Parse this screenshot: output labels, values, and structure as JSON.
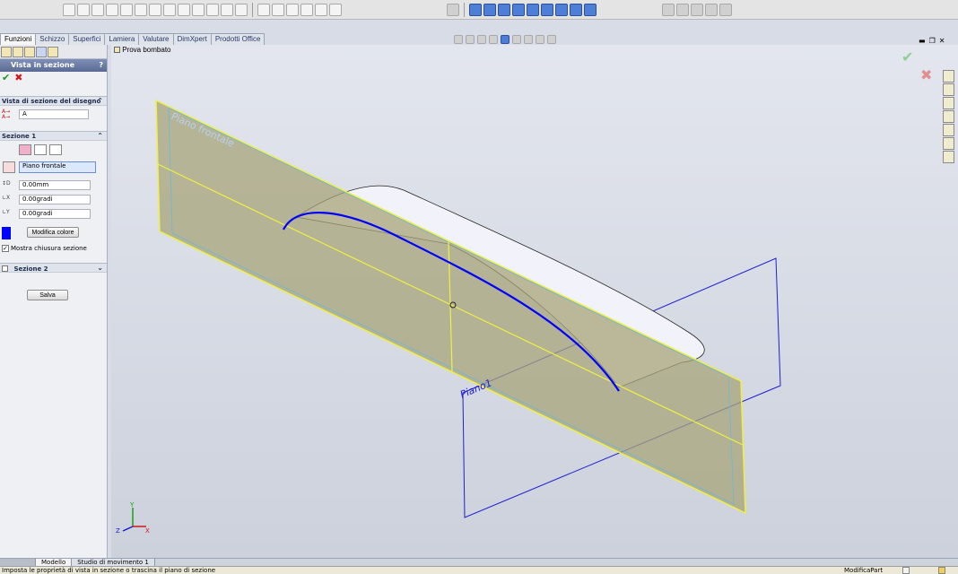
{
  "tabs": [
    "Funzioni",
    "Schizzo",
    "Superfici",
    "Lamiera",
    "Valutare",
    "DimXpert",
    "Prodotti Office"
  ],
  "active_tab": "Funzioni",
  "property_manager": {
    "title": "Vista in sezione",
    "help": "?",
    "section_drawing": {
      "header": "Vista di sezione del disegno",
      "label_value": "A"
    },
    "section1": {
      "header": "Sezione 1",
      "plane": "Piano frontale",
      "offset": "0.00mm",
      "angle_x": "0.00gradi",
      "angle_y": "0.00gradi",
      "color_button": "Modifica colore",
      "show_cap_label": "Mostra chiusura sezione",
      "show_cap_checked": true
    },
    "section2": {
      "header": "Sezione 2"
    },
    "save_button": "Salva"
  },
  "viewport": {
    "tree_label": "Prova bombato",
    "plane_front_label": "Piano frontale",
    "plane1_label": "Piano1",
    "axis_x": "X",
    "axis_y": "Y",
    "axis_z": "Z"
  },
  "bottom_tabs": [
    "Modello",
    "Studio di movimento 1"
  ],
  "status": {
    "message": "Imposta le proprietà di vista in sezione o trascina il piano di sezione",
    "mode": "ModificaPart"
  },
  "colors": {
    "section_color": "#0000ff",
    "front_plane_fill": "#a8a47a",
    "plane_edge": "#f0f040",
    "plane1_edge": "#2020d0"
  }
}
